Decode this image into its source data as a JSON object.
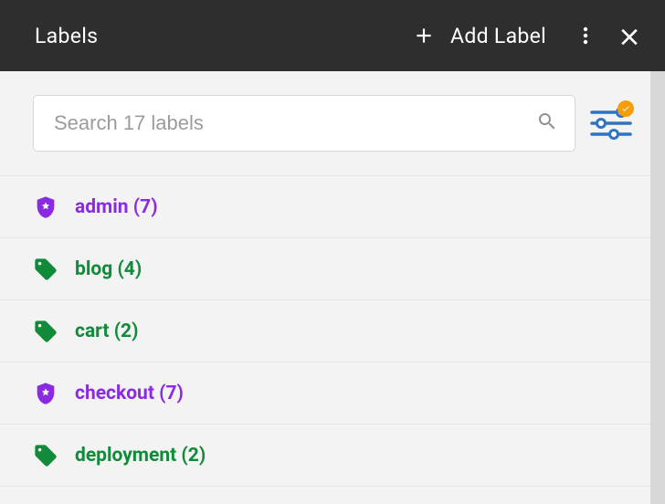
{
  "header": {
    "title": "Labels",
    "add_label": "Add Label"
  },
  "search": {
    "placeholder": "Search 17 labels"
  },
  "colors": {
    "purple": "#8a2be2",
    "green": "#118a3a"
  },
  "labels": [
    {
      "name": "admin",
      "count": 7,
      "icon": "shield",
      "color": "purple",
      "display": "admin (7)"
    },
    {
      "name": "blog",
      "count": 4,
      "icon": "tag",
      "color": "green",
      "display": "blog (4)"
    },
    {
      "name": "cart",
      "count": 2,
      "icon": "tag",
      "color": "green",
      "display": "cart (2)"
    },
    {
      "name": "checkout",
      "count": 7,
      "icon": "shield",
      "color": "purple",
      "display": "checkout (7)"
    },
    {
      "name": "deployment",
      "count": 2,
      "icon": "tag",
      "color": "green",
      "display": "deployment (2)"
    }
  ]
}
